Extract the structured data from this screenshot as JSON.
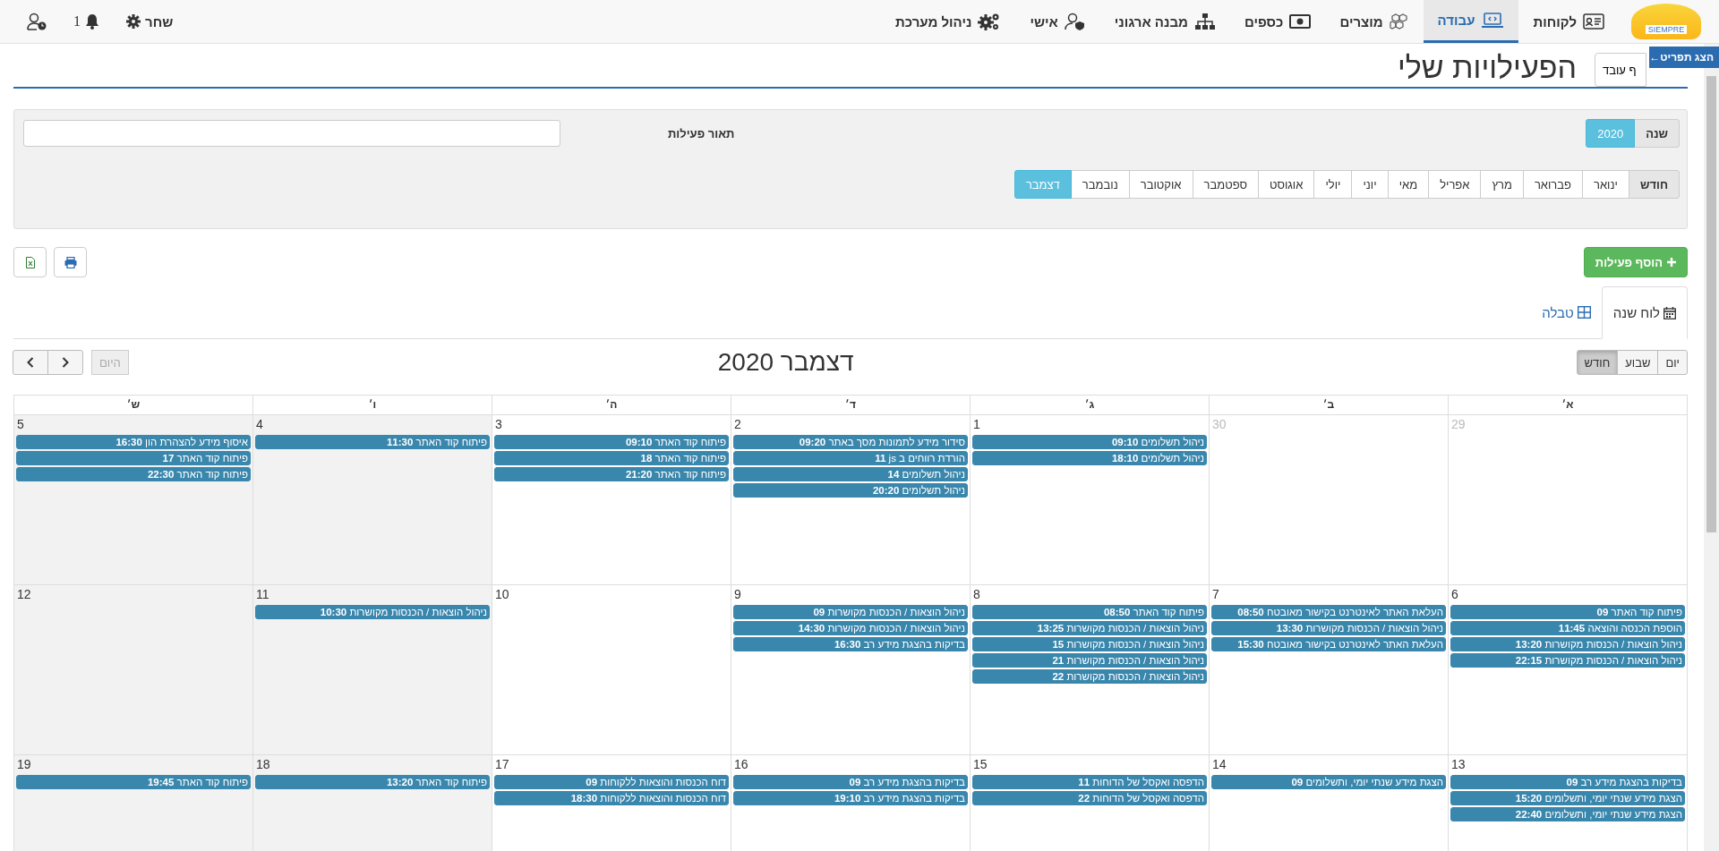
{
  "navbar": {
    "logo_text": "SIEMPRE",
    "items": [
      {
        "label": "לקוחות",
        "selected": false
      },
      {
        "label": "עבודה",
        "selected": true
      },
      {
        "label": "מוצרים",
        "selected": false
      },
      {
        "label": "כספים",
        "selected": false
      },
      {
        "label": "מבנה ארגוני",
        "selected": false
      },
      {
        "label": "אישי",
        "selected": false
      },
      {
        "label": "ניהול מערכת",
        "selected": false
      }
    ],
    "notifications_count": "1",
    "user_name": "שחר"
  },
  "menu_toggle": "הצג תפריט←",
  "header": {
    "title": "הפעילויות שלי",
    "switch_employee_button": "ף עובד"
  },
  "filters": {
    "year_label": "שנה",
    "years": [
      {
        "label": "2020",
        "selected": true
      }
    ],
    "description_label": "תאור פעילות",
    "month_label": "חודש",
    "months": [
      {
        "label": "ינואר",
        "selected": false
      },
      {
        "label": "פברואר",
        "selected": false
      },
      {
        "label": "מרץ",
        "selected": false
      },
      {
        "label": "אפריל",
        "selected": false
      },
      {
        "label": "מאי",
        "selected": false
      },
      {
        "label": "יוני",
        "selected": false
      },
      {
        "label": "יולי",
        "selected": false
      },
      {
        "label": "אוגוסט",
        "selected": false
      },
      {
        "label": "ספטמבר",
        "selected": false
      },
      {
        "label": "אוקטובר",
        "selected": false
      },
      {
        "label": "נובמבר",
        "selected": false
      },
      {
        "label": "דצמבר",
        "selected": true
      }
    ]
  },
  "add_button": "הוסף פעילות",
  "view_tabs": [
    {
      "label": "לוח שנה",
      "selected": true
    },
    {
      "label": "טבלה",
      "selected": false
    }
  ],
  "calendar": {
    "title": "דצמבר 2020",
    "today_button": {
      "label": "היום",
      "disabled": true
    },
    "views": [
      {
        "label": "יום",
        "selected": false
      },
      {
        "label": "שבוע",
        "selected": false
      },
      {
        "label": "חודש",
        "selected": true
      }
    ],
    "columns": [
      {
        "label": "א׳",
        "shaded": false
      },
      {
        "label": "ב׳",
        "shaded": false
      },
      {
        "label": "ג׳",
        "shaded": false
      },
      {
        "label": "ד׳",
        "shaded": false
      },
      {
        "label": "ה׳",
        "shaded": false
      },
      {
        "label": "ו׳",
        "shaded": true
      },
      {
        "label": "ש׳",
        "shaded": true
      }
    ],
    "weeks": [
      [
        {
          "day": "29",
          "other_month": true
        },
        {
          "day": "30",
          "other_month": true
        },
        {
          "day": "1",
          "other_month": false,
          "events": [
            {
              "time": "09:10",
              "title": "ניהול תשלומים"
            },
            {
              "time": "18:10",
              "title": "ניהול תשלומים"
            }
          ]
        },
        {
          "day": "2",
          "other_month": false,
          "events": [
            {
              "time": "09:20",
              "title": "סידור מידע לתמונות מסך באתר"
            },
            {
              "time": "11",
              "title": "הורדת רווחים ב js"
            },
            {
              "time": "14",
              "title": "ניהול תשלומים"
            },
            {
              "time": "20:20",
              "title": "ניהול תשלומים"
            }
          ]
        },
        {
          "day": "3",
          "other_month": false,
          "events": [
            {
              "time": "09:10",
              "title": "פיתוח קוד האתר"
            },
            {
              "time": "18",
              "title": "פיתוח קוד האתר"
            },
            {
              "time": "21:20",
              "title": "פיתוח קוד האתר"
            }
          ]
        },
        {
          "day": "4",
          "other_month": false,
          "events": [
            {
              "time": "11:30",
              "title": "פיתוח קוד האתר"
            }
          ]
        },
        {
          "day": "5",
          "other_month": false,
          "events": [
            {
              "time": "16:30",
              "title": "איסוף מידע להצהרת הון"
            },
            {
              "time": "17",
              "title": "פיתוח קוד האתר"
            },
            {
              "time": "22:30",
              "title": "פיתוח קוד האתר"
            }
          ]
        }
      ],
      [
        {
          "day": "6",
          "other_month": false,
          "events": [
            {
              "time": "09",
              "title": "פיתוח קוד האתר"
            },
            {
              "time": "11:45",
              "title": "הוספת הכנסה והוצאה"
            },
            {
              "time": "13:20",
              "title": "ניהול הוצאות / הכנסות מקושרות"
            },
            {
              "time": "22:15",
              "title": "ניהול הוצאות / הכנסות מקושרות"
            }
          ]
        },
        {
          "day": "7",
          "other_month": false,
          "events": [
            {
              "time": "08:50",
              "title": "העלאת האתר לאינטרנט בקישור מאובטח"
            },
            {
              "time": "13:30",
              "title": "ניהול הוצאות / הכנסות מקושרות"
            },
            {
              "time": "15:30",
              "title": "העלאת האתר לאינטרנט בקישור מאובטח"
            }
          ]
        },
        {
          "day": "8",
          "other_month": false,
          "events": [
            {
              "time": "08:50",
              "title": "פיתוח קוד האתר"
            },
            {
              "time": "13:25",
              "title": "ניהול הוצאות / הכנסות מקושרות"
            },
            {
              "time": "15",
              "title": "ניהול הוצאות / הכנסות מקושרות"
            },
            {
              "time": "21",
              "title": "ניהול הוצאות / הכנסות מקושרות"
            },
            {
              "time": "22",
              "title": "ניהול הוצאות / הכנסות מקושרות"
            }
          ]
        },
        {
          "day": "9",
          "other_month": false,
          "events": [
            {
              "time": "09",
              "title": "ניהול הוצאות / הכנסות מקושרות"
            },
            {
              "time": "14:30",
              "title": "ניהול הוצאות / הכנסות מקושרות"
            },
            {
              "time": "16:30",
              "title": "בדיקות בהצגת מידע רב"
            }
          ]
        },
        {
          "day": "10",
          "other_month": false
        },
        {
          "day": "11",
          "other_month": false,
          "events": [
            {
              "time": "10:30",
              "title": "ניהול הוצאות / הכנסות מקושרות"
            }
          ]
        },
        {
          "day": "12",
          "other_month": false
        }
      ],
      [
        {
          "day": "13",
          "other_month": false,
          "events": [
            {
              "time": "09",
              "title": "בדיקות בהצגת מידע רב"
            },
            {
              "time": "15:20",
              "title": "הצגת מידע שנתי יומי, ותשלומים"
            },
            {
              "time": "22:40",
              "title": "הצגת מידע שנתי יומי, ותשלומים"
            }
          ]
        },
        {
          "day": "14",
          "other_month": false,
          "events": [
            {
              "time": "09",
              "title": "הצגת מידע שנתי יומי, ותשלומים"
            }
          ]
        },
        {
          "day": "15",
          "other_month": false,
          "events": [
            {
              "time": "11",
              "title": "הדפסה ואקסל של הדוחות"
            },
            {
              "time": "22",
              "title": "הדפסה ואקסל של הדוחות"
            }
          ]
        },
        {
          "day": "16",
          "other_month": false,
          "events": [
            {
              "time": "09",
              "title": "בדיקות בהצגת מידע רב"
            },
            {
              "time": "19:10",
              "title": "בדיקות בהצגת מידע רב"
            }
          ]
        },
        {
          "day": "17",
          "other_month": false,
          "events": [
            {
              "time": "09",
              "title": "דוח הכנסות והוצאות ללקוחות"
            },
            {
              "time": "18:30",
              "title": "דוח הכנסות והוצאות ללקוחות"
            }
          ]
        },
        {
          "day": "18",
          "other_month": false,
          "events": [
            {
              "time": "13:20",
              "title": "פיתוח קוד האתר"
            }
          ]
        },
        {
          "day": "19",
          "other_month": false,
          "events": [
            {
              "time": "19:45",
              "title": "פיתוח קוד האתר"
            }
          ]
        }
      ]
    ]
  }
}
